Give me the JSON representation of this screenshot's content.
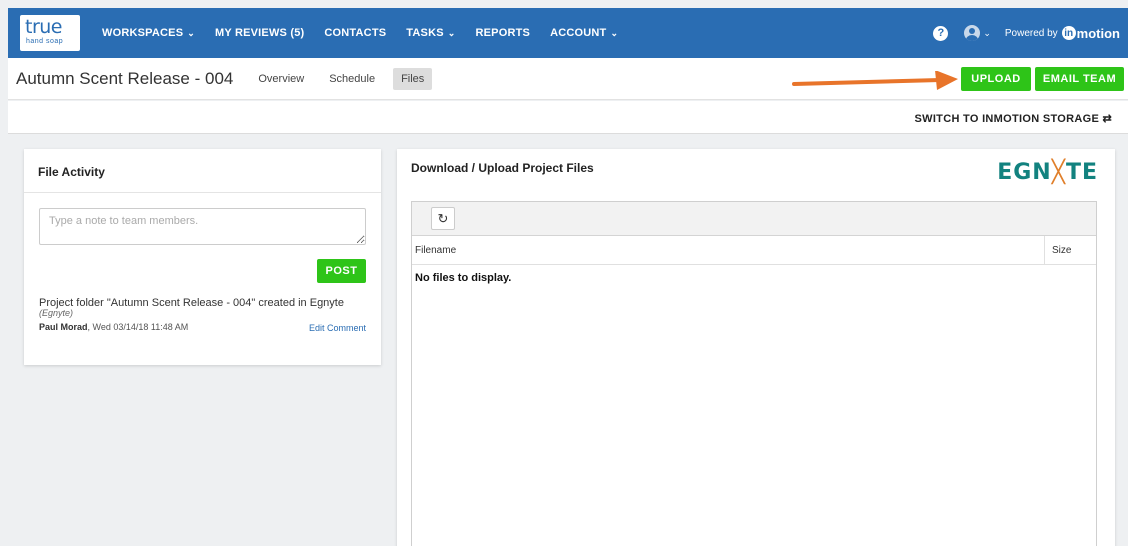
{
  "brand": {
    "logo_main": "true",
    "logo_sub": "hand soap",
    "nav_color": "#2a6db3"
  },
  "nav": {
    "items": [
      {
        "label": "WORKSPACES",
        "has_dropdown": true
      },
      {
        "label": "MY REVIEWS (5)",
        "has_dropdown": false
      },
      {
        "label": "CONTACTS",
        "has_dropdown": false
      },
      {
        "label": "TASKS",
        "has_dropdown": true
      },
      {
        "label": "REPORTS",
        "has_dropdown": false
      },
      {
        "label": "ACCOUNT",
        "has_dropdown": true
      }
    ],
    "help_icon": "?",
    "powered_by": "Powered by",
    "powered_logo": "motion",
    "powered_logo_prefix": "in"
  },
  "project": {
    "title": "Autumn Scent Release - 004",
    "tabs": [
      {
        "label": "Overview",
        "active": false
      },
      {
        "label": "Schedule",
        "active": false
      },
      {
        "label": "Files",
        "active": true
      }
    ]
  },
  "actions": {
    "upload": "UPLOAD",
    "email_team": "EMAIL TEAM",
    "accent": "#2ec418",
    "arrow_color": "#e8742a"
  },
  "storage": {
    "switch_label": "SWITCH TO INMOTION STORAGE ⇄"
  },
  "file_activity": {
    "title": "File Activity",
    "note_placeholder": "Type a note to team members.",
    "post_label": "POST",
    "entries": [
      {
        "text": "Project folder \"Autumn Scent Release - 004\" created in Egnyte",
        "source": "(Egnyte)",
        "author": "Paul Morad",
        "date": ", Wed 03/14/18 11:48 AM",
        "action": "Edit Comment"
      }
    ]
  },
  "files": {
    "title": "Download / Upload Project Files",
    "provider_logo_a": "EGN",
    "provider_logo_x": "╳",
    "provider_logo_b": "TE",
    "refresh_icon": "refresh-icon",
    "columns": [
      "Filename",
      "Size"
    ],
    "empty_message": "No files to display."
  }
}
